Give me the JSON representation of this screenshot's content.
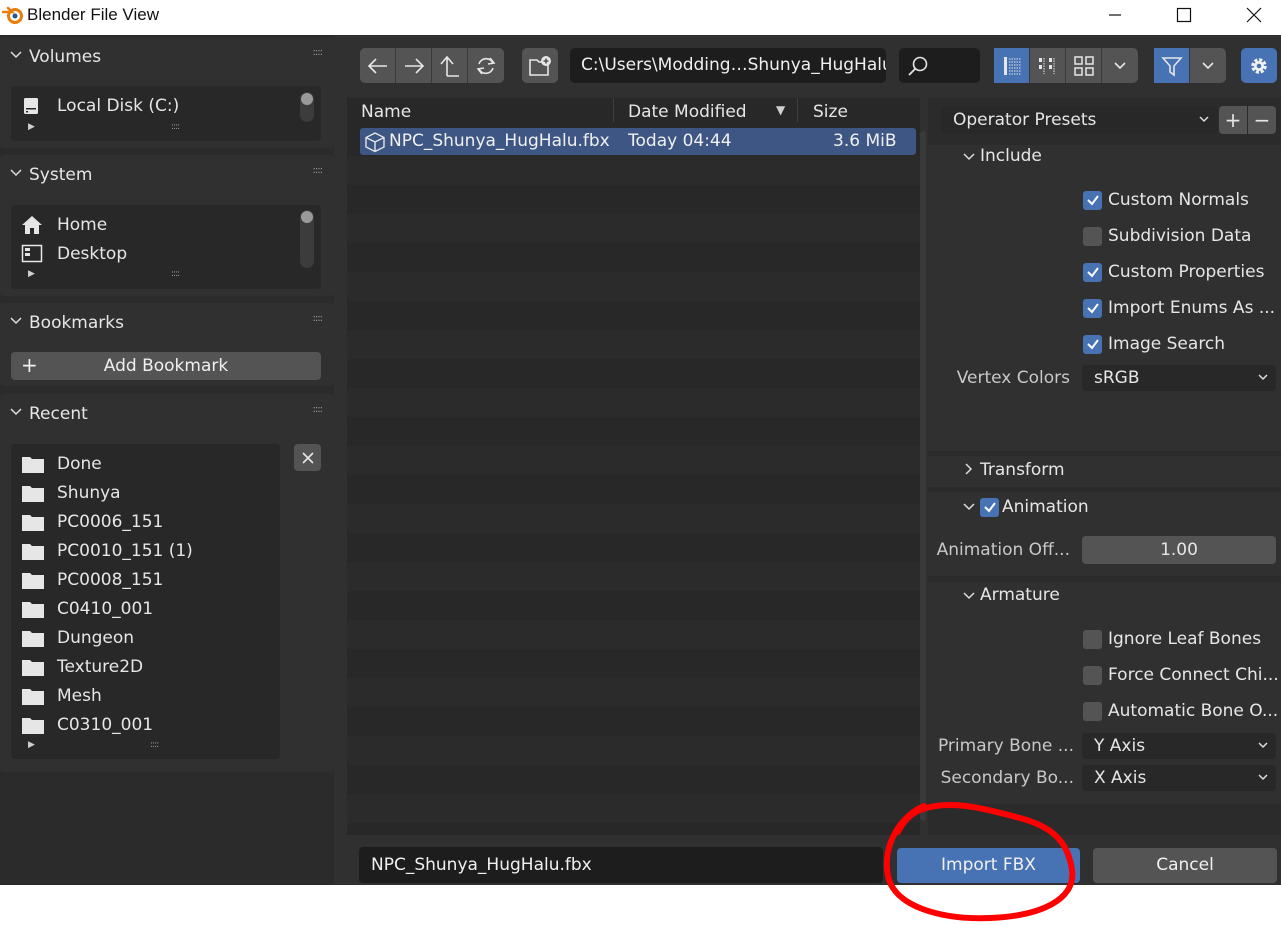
{
  "window": {
    "title": "Blender File View"
  },
  "sidebar": {
    "volumes": {
      "title": "Volumes",
      "items": [
        {
          "label": "Local Disk (C:)",
          "icon": "disk-icon"
        }
      ]
    },
    "system": {
      "title": "System",
      "items": [
        {
          "label": "Home",
          "icon": "home-icon"
        },
        {
          "label": "Desktop",
          "icon": "desktop-icon"
        }
      ]
    },
    "bookmarks": {
      "title": "Bookmarks",
      "add_label": "Add Bookmark"
    },
    "recent": {
      "title": "Recent",
      "items": [
        {
          "label": "Done"
        },
        {
          "label": "Shunya"
        },
        {
          "label": "PC0006_151"
        },
        {
          "label": "PC0010_151 (1)"
        },
        {
          "label": "PC0008_151"
        },
        {
          "label": "C0410_001"
        },
        {
          "label": "Dungeon"
        },
        {
          "label": "Texture2D"
        },
        {
          "label": "Mesh"
        },
        {
          "label": "C0310_001"
        }
      ]
    }
  },
  "toolbar": {
    "path": "C:\\Users\\Modding…Shunya_HugHalu\\"
  },
  "filelist": {
    "columns": {
      "name": "Name",
      "date": "Date Modified",
      "size": "Size"
    },
    "files": [
      {
        "name": "NPC_Shunya_HugHalu.fbx",
        "date": "Today 04:44",
        "size": "3.6 MiB"
      }
    ]
  },
  "options": {
    "preset_label": "Operator Presets",
    "include": {
      "title": "Include",
      "checks": [
        {
          "label": "Custom Normals",
          "checked": true
        },
        {
          "label": "Subdivision Data",
          "checked": false
        },
        {
          "label": "Custom Properties",
          "checked": true
        },
        {
          "label": "Import Enums As ...",
          "checked": true
        },
        {
          "label": "Image Search",
          "checked": true
        }
      ],
      "vertex_colors_label": "Vertex Colors",
      "vertex_colors_value": "sRGB"
    },
    "transform": {
      "title": "Transform"
    },
    "animation": {
      "title": "Animation",
      "checked": true,
      "offset_label": "Animation Off...",
      "offset_value": "1.00"
    },
    "armature": {
      "title": "Armature",
      "checks": [
        {
          "label": "Ignore Leaf Bones",
          "checked": false
        },
        {
          "label": "Force Connect Chi...",
          "checked": false
        },
        {
          "label": "Automatic Bone O...",
          "checked": false
        }
      ],
      "primary_label": "Primary Bone ...",
      "primary_value": "Y Axis",
      "secondary_label": "Secondary Bo...",
      "secondary_value": "X Axis"
    }
  },
  "footer": {
    "filename": "NPC_Shunya_HugHalu.fbx",
    "import_label": "Import FBX",
    "cancel_label": "Cancel"
  },
  "colors": {
    "accent": "#4772b3",
    "annotation": "#ff0000"
  }
}
